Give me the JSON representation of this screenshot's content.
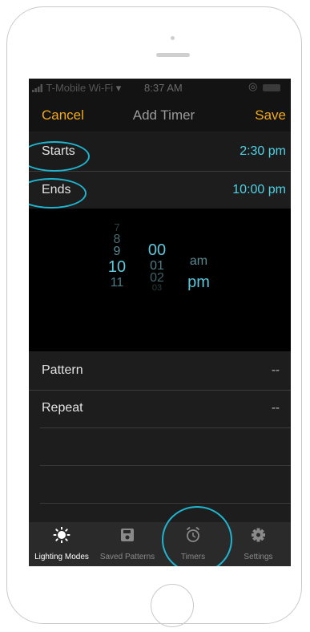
{
  "status_bar": {
    "carrier": "T-Mobile Wi-Fi",
    "time": "8:37 AM"
  },
  "nav": {
    "cancel_label": "Cancel",
    "title": "Add Timer",
    "save_label": "Save"
  },
  "rows": {
    "starts": {
      "label": "Starts",
      "value": "2:30 pm"
    },
    "ends": {
      "label": "Ends",
      "value": "10:00 pm"
    },
    "pattern": {
      "label": "Pattern",
      "value": "--"
    },
    "repeat": {
      "label": "Repeat",
      "value": "--"
    }
  },
  "picker": {
    "hours": [
      "7",
      "8",
      "9",
      "10",
      "11"
    ],
    "selected_hour": "10",
    "minutes": [
      "00",
      "01",
      "02",
      "03"
    ],
    "selected_minute": "00",
    "periods": [
      "am",
      "pm"
    ],
    "selected_period": "pm"
  },
  "tabs": [
    {
      "label": "Lighting Modes",
      "icon": "sun-icon",
      "active": true
    },
    {
      "label": "Saved Patterns",
      "icon": "floppy-disk-icon",
      "active": false
    },
    {
      "label": "Timers",
      "icon": "alarm-clock-icon",
      "active": false
    },
    {
      "label": "Settings",
      "icon": "gear-icon",
      "active": false
    }
  ],
  "colors": {
    "accent": "#f2a81d",
    "value": "#4fd3e6",
    "highlight_ring": "#1fb4cf"
  }
}
